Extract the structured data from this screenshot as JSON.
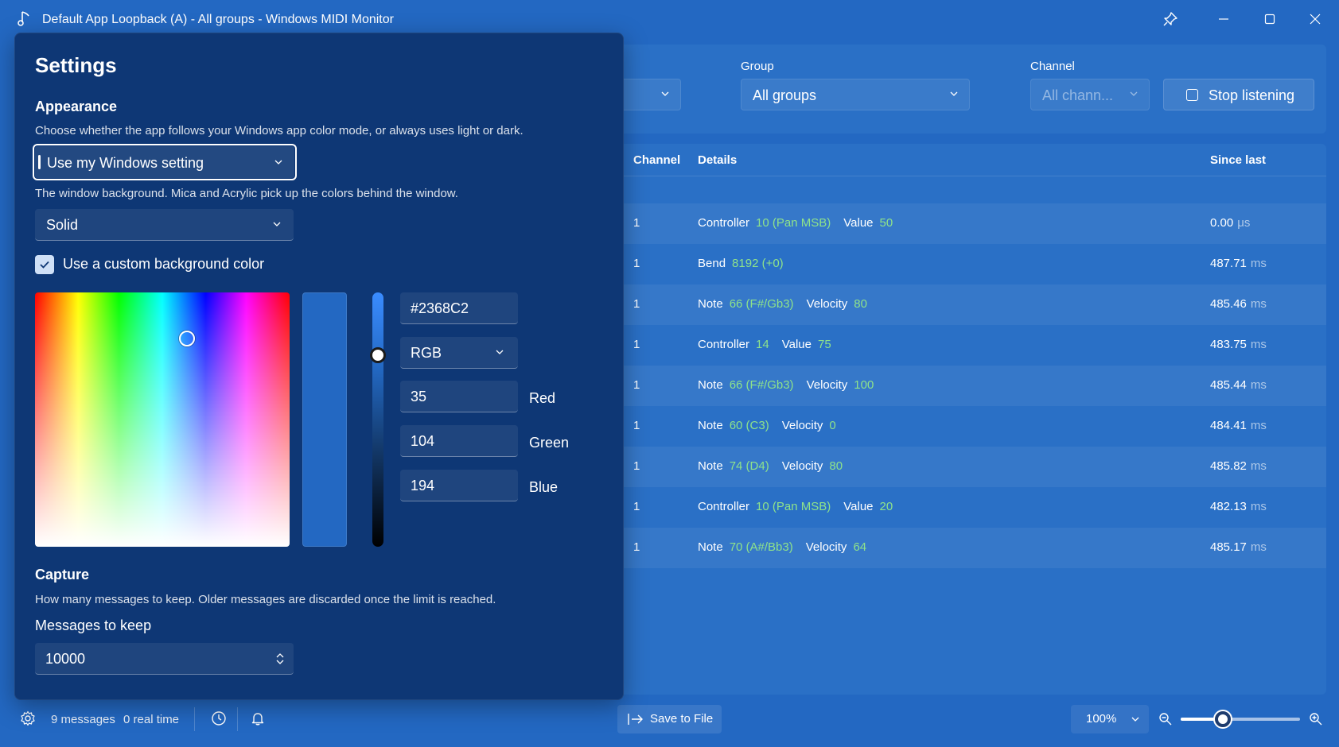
{
  "window": {
    "title": "Default App Loopback (A) - All groups - Windows MIDI Monitor",
    "icons": [
      "music-note-icon",
      "pin-icon",
      "minimize-icon",
      "maximize-icon",
      "close-icon"
    ]
  },
  "filters": {
    "group_label": "Group",
    "group_value": "All groups",
    "channel_label": "Channel",
    "channel_value": "All chann...",
    "stop_label": "Stop listening"
  },
  "table": {
    "headers": {
      "channel": "Channel",
      "details": "Details",
      "since_last": "Since last"
    },
    "rows": [
      {
        "channel": "1",
        "d1": "Controller",
        "v1": "10 (Pan MSB)",
        "d2": "Value",
        "v2": "50",
        "since": "0.00",
        "unit": "μs"
      },
      {
        "channel": "1",
        "d1": "Bend",
        "v1": "8192 (+0)",
        "d2": "",
        "v2": "",
        "since": "487.71",
        "unit": "ms"
      },
      {
        "channel": "1",
        "d1": "Note",
        "v1": "66 (F#/Gb3)",
        "d2": "Velocity",
        "v2": "80",
        "since": "485.46",
        "unit": "ms"
      },
      {
        "channel": "1",
        "d1": "Controller",
        "v1": "14",
        "d2": "Value",
        "v2": "75",
        "since": "483.75",
        "unit": "ms"
      },
      {
        "channel": "1",
        "d1": "Note",
        "v1": "66 (F#/Gb3)",
        "d2": "Velocity",
        "v2": "100",
        "since": "485.44",
        "unit": "ms"
      },
      {
        "channel": "1",
        "d1": "Note",
        "v1": "60 (C3)",
        "d2": "Velocity",
        "v2": "0",
        "since": "484.41",
        "unit": "ms"
      },
      {
        "channel": "1",
        "d1": "Note",
        "v1": "74 (D4)",
        "d2": "Velocity",
        "v2": "80",
        "since": "485.82",
        "unit": "ms"
      },
      {
        "channel": "1",
        "d1": "Controller",
        "v1": "10 (Pan MSB)",
        "d2": "Value",
        "v2": "20",
        "since": "482.13",
        "unit": "ms"
      },
      {
        "channel": "1",
        "d1": "Note",
        "v1": "70 (A#/Bb3)",
        "d2": "Velocity",
        "v2": "64",
        "since": "485.17",
        "unit": "ms"
      }
    ]
  },
  "settings": {
    "title": "Settings",
    "appearance": {
      "heading": "Appearance",
      "mode_desc": "Choose whether the app follows your Windows app color mode, or always uses light or dark.",
      "mode_value": "Use my Windows setting",
      "bg_desc": "The window background. Mica and Acrylic pick up the colors behind the window.",
      "bg_value": "Solid",
      "custom_color_label": "Use a custom background color",
      "custom_color_checked": true
    },
    "color": {
      "hex": "#2368C2",
      "model": "RGB",
      "red_label": "Red",
      "red": "35",
      "green_label": "Green",
      "green": "104",
      "blue_label": "Blue",
      "blue": "194",
      "preview_color": "#2368C2"
    },
    "capture": {
      "heading": "Capture",
      "desc": "How many messages to keep. Older messages are discarded once the limit is reached.",
      "keep_label": "Messages to keep",
      "keep_value": "10000"
    }
  },
  "statusbar": {
    "messages": "9 messages",
    "realtime": "0 real time",
    "save_label": "Save to File",
    "zoom": "100%",
    "zoom_level_fraction": 0.35
  },
  "colors": {
    "accent_bg": "#2368C2",
    "panel_bg": "#0e3775",
    "value_green": "#8fe38a"
  }
}
